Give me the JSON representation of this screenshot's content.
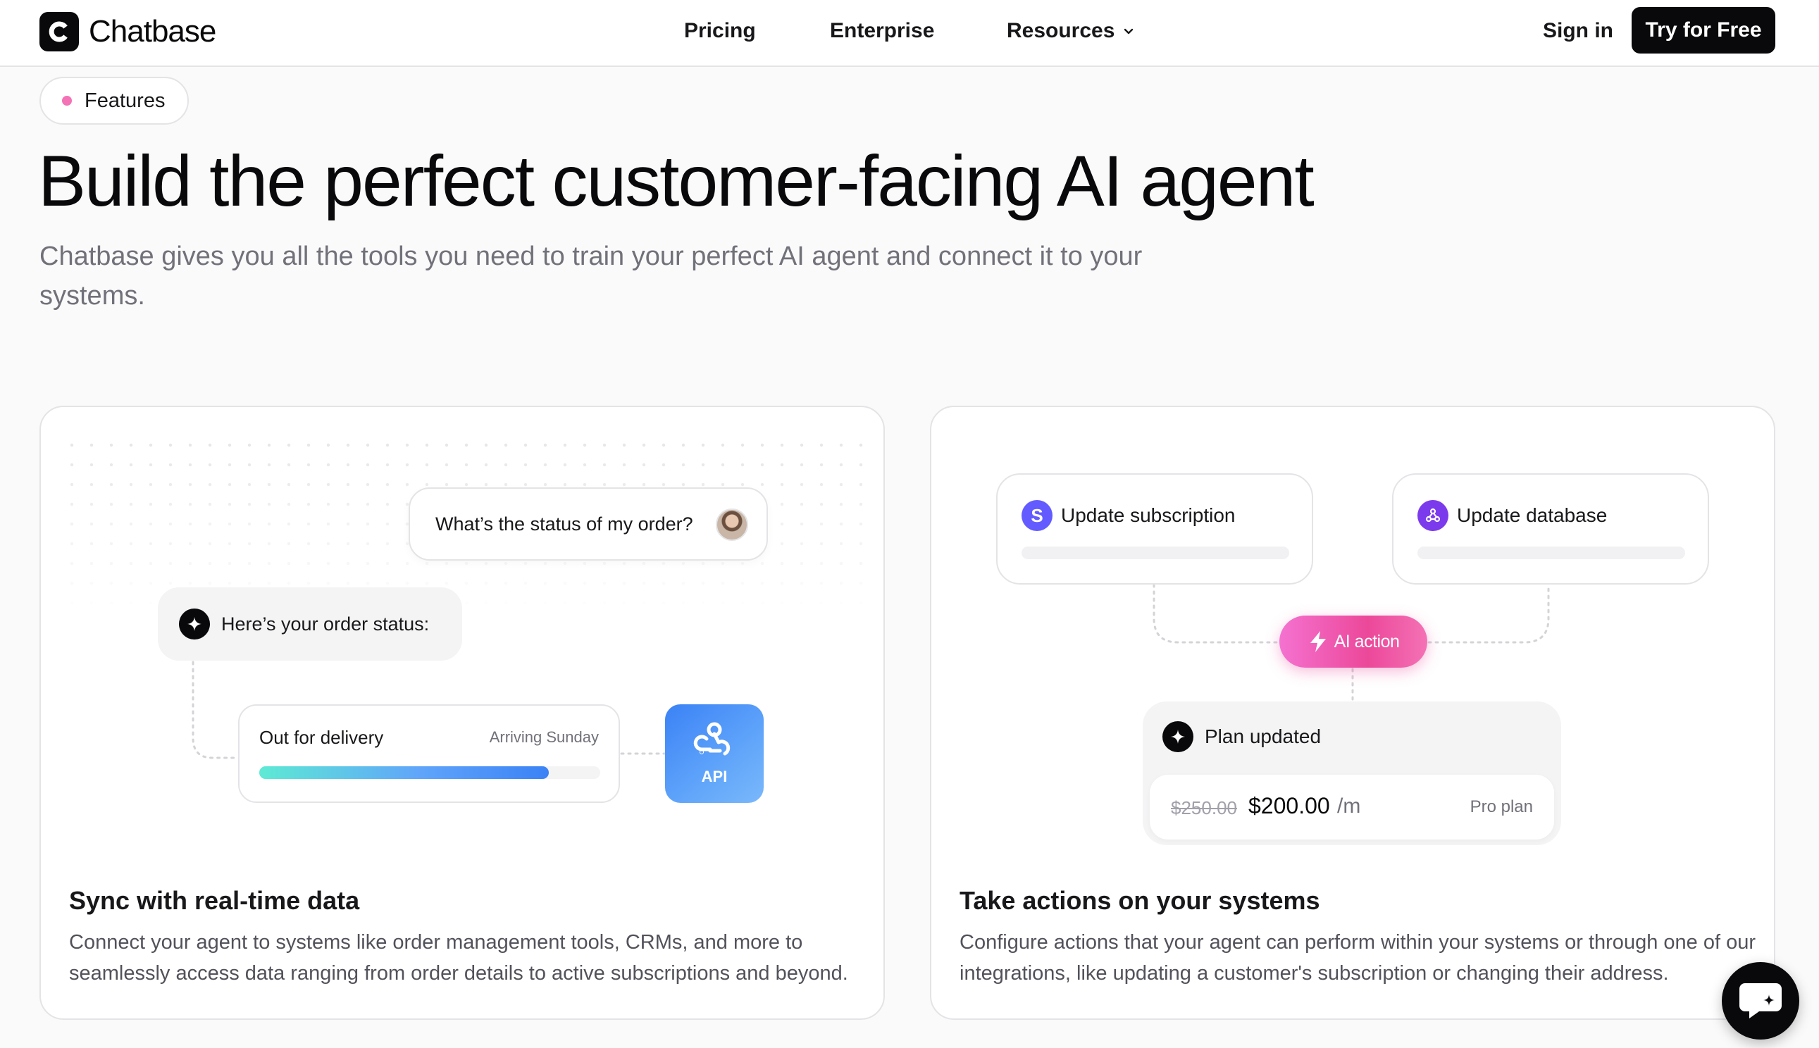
{
  "brand": {
    "name": "Chatbase"
  },
  "nav": {
    "pricing": "Pricing",
    "enterprise": "Enterprise",
    "resources": "Resources",
    "sign_in": "Sign in",
    "try_free": "Try for Free"
  },
  "hero": {
    "badge": "Features",
    "title": "Build the perfect customer-facing AI agent",
    "subtitle": "Chatbase gives you all the tools you need to train your perfect AI agent and connect it to your systems."
  },
  "card_sync": {
    "user_message": "What’s the status of my order?",
    "bot_message": "Here’s your order status:",
    "delivery_label": "Out for delivery",
    "delivery_eta": "Arriving Sunday",
    "progress": 0.85,
    "api_label": "API",
    "title": "Sync with real-time data",
    "description": "Connect your agent to systems like order management tools, CRMs, and more to seamlessly access data ranging from order details to active subscriptions and beyond."
  },
  "card_actions": {
    "action_1": {
      "label": "Update subscription",
      "icon": "S"
    },
    "action_2": {
      "label": "Update database"
    },
    "ai_action": "AI action",
    "plan_status": "Plan updated",
    "old_price": "$250.00",
    "new_price": "$200.00",
    "period": "/m",
    "plan_name": "Pro plan",
    "title": "Take actions on your systems",
    "description": "Configure actions that your agent can perform within your systems or through one of our integrations, like updating a customer's subscription or changing their address."
  },
  "colors": {
    "accent_pink": "#ec4899",
    "api_blue": "#3b82f6",
    "stripe_purple": "#635bff",
    "db_purple": "#7c3aed"
  }
}
